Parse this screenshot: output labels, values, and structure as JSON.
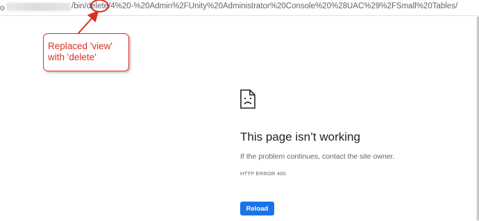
{
  "address_bar": {
    "edge_char": "o",
    "url_segments": {
      "before": "/bin/",
      "highlighted": "delete",
      "after": "/4%20-%20Admin%2FUnity%20Administrator%20Console%20%28UAC%29%2FSmall%20Tables/"
    }
  },
  "annotation": {
    "line1": "Replaced 'view'",
    "line2": "with 'delete'",
    "color": "#d93025"
  },
  "error_page": {
    "icon": "sad-document-icon",
    "title": "This page isn’t working",
    "message": "If the problem continues, contact the site owner.",
    "code": "HTTP ERROR 400",
    "reload_label": "Reload",
    "button_color": "#1a73e8"
  }
}
